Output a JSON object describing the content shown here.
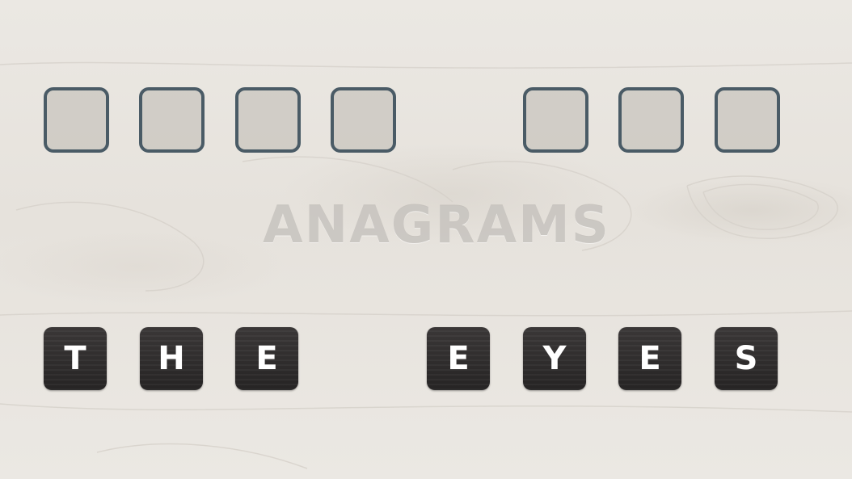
{
  "title": "ANAGRAMS",
  "answer_slots": {
    "word_1": [
      "",
      "",
      "",
      ""
    ],
    "word_2": [
      "",
      "",
      ""
    ]
  },
  "letter_tiles": {
    "group_1": [
      "T",
      "H",
      "E"
    ],
    "group_2": [
      "E",
      "Y",
      "E",
      "S"
    ]
  },
  "colors": {
    "slot_border": "#4a5b66",
    "tile_background": "#2f2c2c",
    "tile_text": "#ffffff",
    "background": "#e9e6e1"
  }
}
